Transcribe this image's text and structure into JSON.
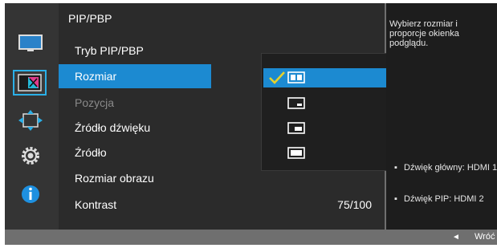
{
  "menu": {
    "title": "PIP/PBP",
    "items": [
      {
        "label": "Tryb PIP/PBP",
        "value": ""
      },
      {
        "label": "Rozmiar",
        "value": ""
      },
      {
        "label": "Pozycja",
        "value": ""
      },
      {
        "label": "Źródło dźwięku",
        "value": ""
      },
      {
        "label": "Źródło",
        "value": ""
      },
      {
        "label": "Rozmiar obrazu",
        "value": ""
      },
      {
        "label": "Kontrast",
        "value": "75/100"
      }
    ],
    "selected_index": 1,
    "disabled_index": 2
  },
  "dropdown": {
    "options": [
      {
        "icon": "split-window-icon",
        "selected": true
      },
      {
        "icon": "small-window-icon",
        "selected": false
      },
      {
        "icon": "medium-window-icon",
        "selected": false
      },
      {
        "icon": "large-window-icon",
        "selected": false
      }
    ],
    "check_glyph": "✓"
  },
  "sidebar": {
    "icons": [
      {
        "name": "picture-icon",
        "active": false
      },
      {
        "name": "color-icon",
        "active": true
      },
      {
        "name": "position-icon",
        "active": false
      },
      {
        "name": "system-gear-icon",
        "active": false
      },
      {
        "name": "info-icon",
        "active": false
      }
    ]
  },
  "help": {
    "description": "Wybierz rozmiar i proporcje okienka podglądu.",
    "info": [
      {
        "bullet": "▪",
        "text": "Dźwięk główny: HDMI 1"
      },
      {
        "bullet": "▪",
        "text": "Dźwięk PIP: HDMI 2"
      }
    ]
  },
  "footer": {
    "back_arrow": "◄",
    "back_label": "Wróć"
  },
  "colors": {
    "accent": "#1c8ad1",
    "check": "#e6d12b",
    "frame": "#6f6f6f",
    "menu_bg": "#2b2b2b"
  }
}
